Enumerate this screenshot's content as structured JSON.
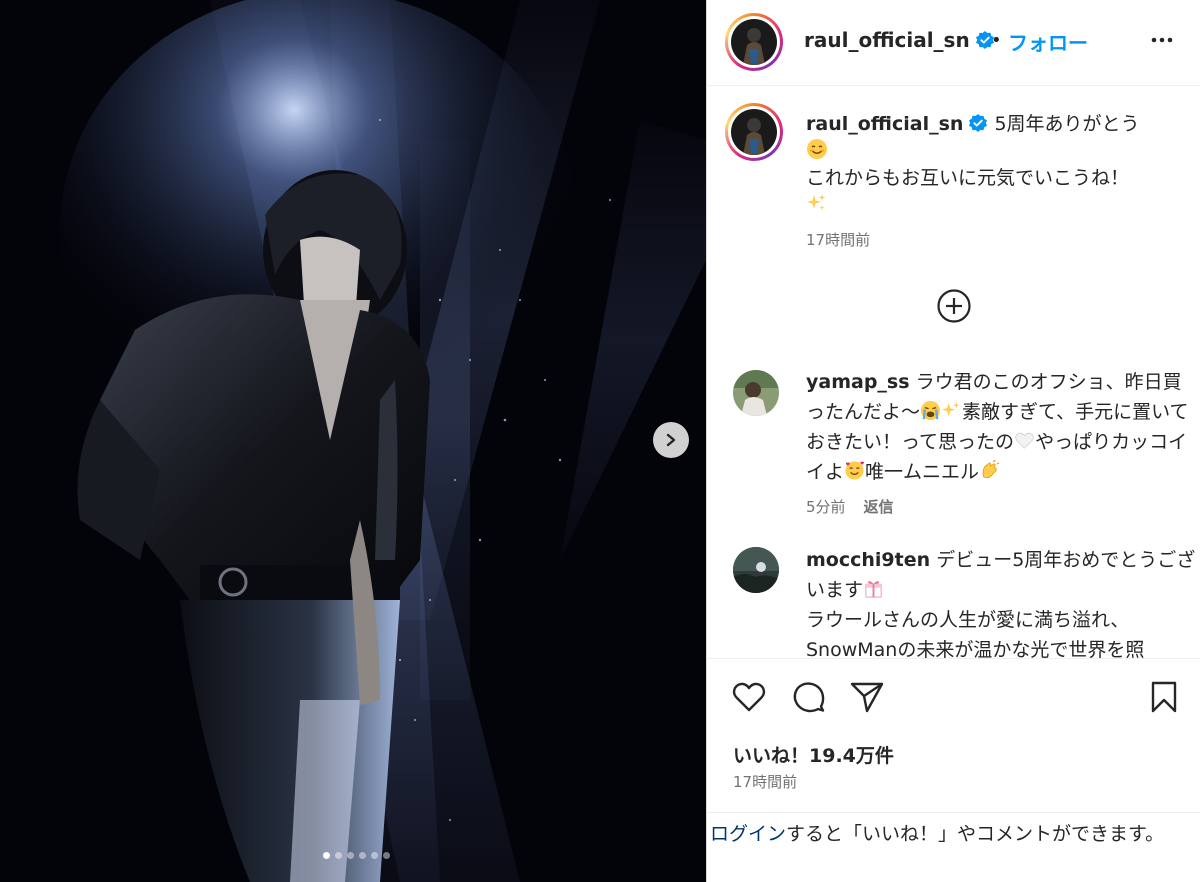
{
  "post": {
    "username": "raul_official_sn",
    "separator": "•",
    "follow_label": "フォロー",
    "more_icon": "more-horizontal-icon"
  },
  "caption": {
    "username": "raul_official_sn",
    "line1": "5周年ありがとう",
    "line2": "これからもお互いに元気でいこうね！",
    "time": "17時間前"
  },
  "comments": [
    {
      "username": "yamap_ss",
      "text_a": "ラウ君のこのオフショ、昨日買ったんだよ〜",
      "text_b": "素敵すぎて、手元に置いておきたい！って思ったの",
      "text_c": "やっぱりカッコイイよ",
      "text_d": "唯一ムニエル",
      "time": "5分前",
      "reply_label": "返信"
    },
    {
      "username": "mocchi9ten",
      "text_a": "デビュー5周年おめでとうございます",
      "text_b": "ラウールさんの人生が愛に満ち溢れ、SnowManの未来が温かな光で世界を照"
    }
  ],
  "actions": {
    "likes": "いいね！19.4万件",
    "time": "17時間前"
  },
  "login": {
    "link_label": "ログイン",
    "rest": "すると「いいね！」やコメントができます。"
  },
  "carousel": {
    "slide_count": 6,
    "active_index": 0
  },
  "colors": {
    "link_blue": "#0095f6",
    "verified_blue": "#0095f6",
    "text": "#262626",
    "muted": "#737373"
  }
}
